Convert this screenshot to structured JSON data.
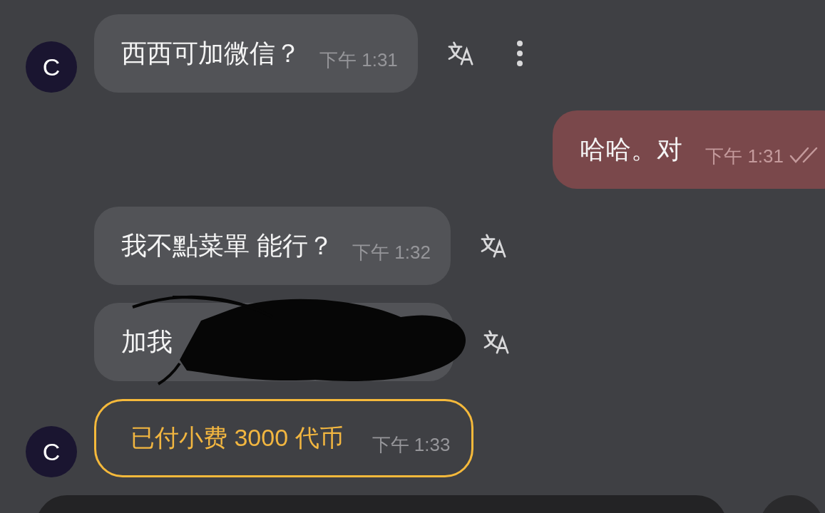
{
  "messages": [
    {
      "kind": "incoming",
      "avatar": "C",
      "text": "西西可加微信？",
      "time": "下午 1:31",
      "translate": true,
      "more": true
    },
    {
      "kind": "outgoing",
      "text": "哈哈。对",
      "time": "下午 1:31",
      "read": true
    },
    {
      "kind": "incoming",
      "text": "我不點菜單 能行？",
      "time": "下午 1:32",
      "translate": true,
      "more": false
    },
    {
      "kind": "incoming",
      "text": "加我",
      "redacted": true,
      "translate": true,
      "more": false
    },
    {
      "kind": "tip",
      "avatar": "C",
      "text": "已付小费 3000 代币",
      "time": "下午 1:33"
    }
  ]
}
